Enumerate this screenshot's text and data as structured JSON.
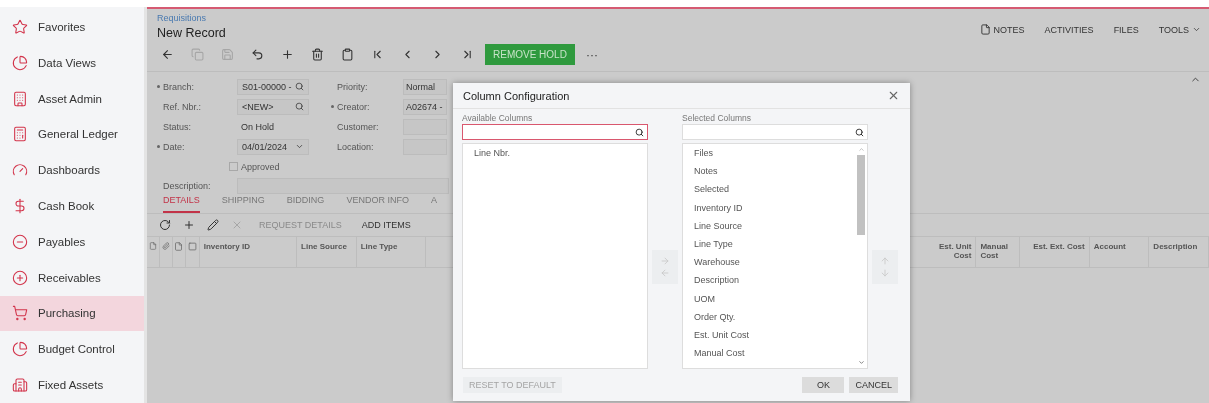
{
  "sidebar": {
    "items": [
      {
        "label": "Favorites",
        "selected": false
      },
      {
        "label": "Data Views",
        "selected": false
      },
      {
        "label": "Asset Admin",
        "selected": false
      },
      {
        "label": "General Ledger",
        "selected": false
      },
      {
        "label": "Dashboards",
        "selected": false
      },
      {
        "label": "Cash Book",
        "selected": false
      },
      {
        "label": "Payables",
        "selected": false
      },
      {
        "label": "Receivables",
        "selected": false
      },
      {
        "label": "Purchasing",
        "selected": true
      },
      {
        "label": "Budget Control",
        "selected": false
      },
      {
        "label": "Fixed Assets",
        "selected": false
      }
    ]
  },
  "header": {
    "breadcrumb": "Requisitions",
    "title": "New Record",
    "links": [
      {
        "label": "NOTES",
        "kind": "doc"
      },
      {
        "label": "ACTIVITIES",
        "kind": "plain"
      },
      {
        "label": "FILES",
        "kind": "plain"
      },
      {
        "label": "TOOLS",
        "kind": "menu"
      }
    ]
  },
  "toolbar": {
    "buttons": [
      {
        "disabled": false
      },
      {
        "disabled": true
      },
      {
        "disabled": true
      },
      {
        "disabled": false
      },
      {
        "disabled": false
      },
      {
        "disabled": false
      },
      {
        "disabled": false
      },
      {
        "disabled": false
      },
      {
        "disabled": false
      },
      {
        "disabled": false
      },
      {
        "disabled": false
      }
    ],
    "primary": "REMOVE HOLD",
    "more": "···"
  },
  "form": {
    "left": [
      {
        "label": "Branch:",
        "required": true,
        "kind": "lookup",
        "value": "S01-00000 -"
      },
      {
        "label": "Ref. Nbr.:",
        "required": false,
        "kind": "lookup",
        "value": "<NEW>"
      },
      {
        "label": "Status:",
        "required": false,
        "kind": "text",
        "value": "On Hold"
      },
      {
        "label": "Date:",
        "required": true,
        "kind": "date",
        "value": "04/01/2024"
      }
    ],
    "approved": {
      "label": "Approved",
      "checked": false
    },
    "middle": [
      {
        "label": "Priority:",
        "required": false,
        "value": "Normal"
      },
      {
        "label": "Creator:",
        "required": true,
        "value": "A02674 -"
      },
      {
        "label": "Customer:",
        "required": false
      },
      {
        "label": "Location:",
        "required": false
      }
    ],
    "description": {
      "label": "Description:"
    }
  },
  "tabs": [
    {
      "label": "DETAILS",
      "selected": true
    },
    {
      "label": "SHIPPING",
      "selected": false
    },
    {
      "label": "BIDDING",
      "selected": false
    },
    {
      "label": "VENDOR INFO",
      "selected": false
    },
    {
      "label": "A",
      "selected": false
    }
  ],
  "grid_toolbar": {
    "icons": [
      {
        "disabled": false
      },
      {
        "disabled": false
      },
      {
        "disabled": false
      },
      {
        "disabled": true
      }
    ],
    "buttons": [
      {
        "label": "REQUEST DETAILS",
        "disabled": true
      },
      {
        "label": "ADD ITEMS",
        "disabled": false
      }
    ]
  },
  "grid": {
    "columns": [
      {
        "label": "Inventory ID",
        "numeric": false
      },
      {
        "label": "Line Source",
        "numeric": false
      },
      {
        "label": "Line Type",
        "numeric": false
      },
      {
        "label": "Est. Unit Cost",
        "numeric": true
      },
      {
        "label": "Manual Cost",
        "numeric": false
      },
      {
        "label": "Est. Ext. Cost",
        "numeric": true
      },
      {
        "label": "Account",
        "numeric": false
      },
      {
        "label": "Description",
        "numeric": false
      }
    ]
  },
  "dialog": {
    "title": "Column Configuration",
    "available": {
      "label": "Available Columns",
      "items": [
        "Line Nbr."
      ]
    },
    "selected": {
      "label": "Selected Columns",
      "items": [
        "Files",
        "Notes",
        "Selected",
        "Inventory ID",
        "Line Source",
        "Line Type",
        "Warehouse",
        "Description",
        "UOM",
        "Order Qty.",
        "Est. Unit Cost",
        "Manual Cost"
      ]
    },
    "move_disabled": true,
    "order_disabled": true,
    "reset": {
      "label": "RESET TO DEFAULT",
      "disabled": true
    },
    "ok": "OK",
    "cancel": "CANCEL"
  }
}
